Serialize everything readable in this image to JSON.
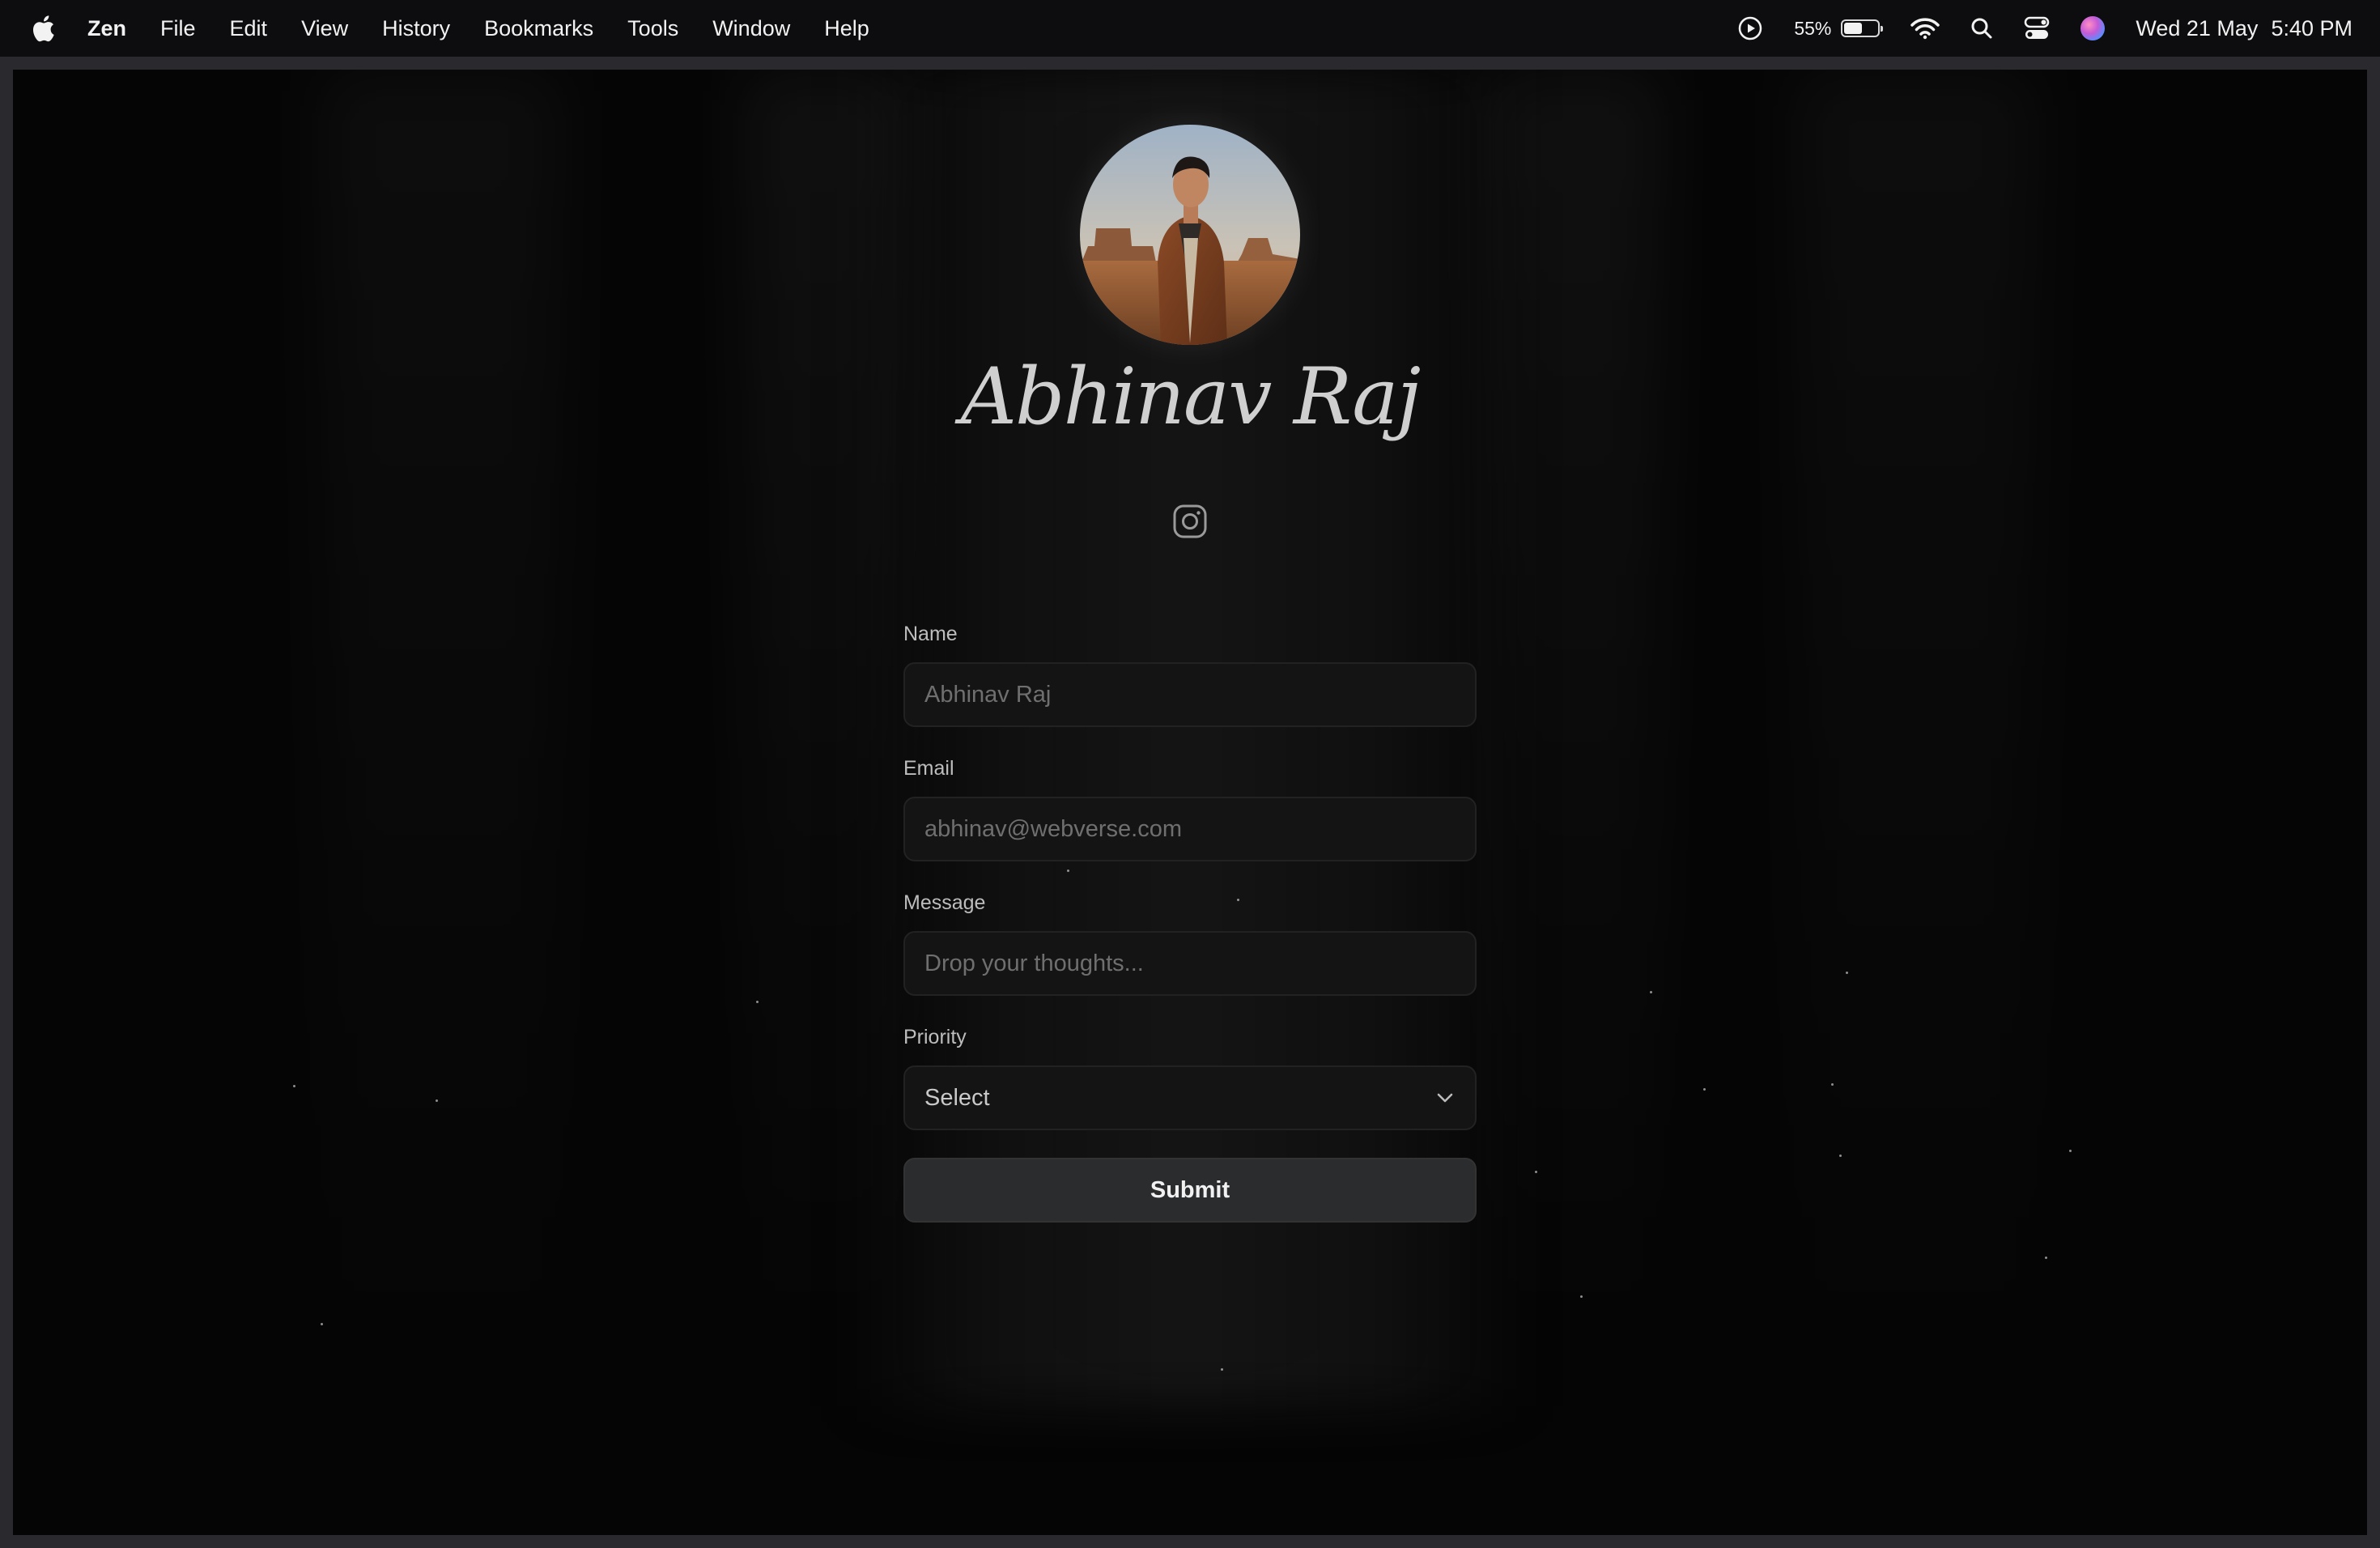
{
  "menubar": {
    "app_name": "Zen",
    "items": [
      "File",
      "Edit",
      "View",
      "History",
      "Bookmarks",
      "Tools",
      "Window",
      "Help"
    ],
    "battery_percent": "55%",
    "battery_level": 0.55,
    "date": "Wed 21 May",
    "time": "5:40 PM",
    "icons": [
      "apple-icon",
      "play-circle-icon",
      "battery-icon",
      "wifi-icon",
      "search-icon",
      "control-center-icon",
      "siri-icon"
    ]
  },
  "profile": {
    "name": "Abhinav Raj",
    "social_icon": "instagram-icon"
  },
  "form": {
    "name_label": "Name",
    "name_placeholder": "Abhinav Raj",
    "email_label": "Email",
    "email_placeholder": "abhinav@webverse.com",
    "message_label": "Message",
    "message_placeholder": "Drop your thoughts...",
    "priority_label": "Priority",
    "priority_value": "Select",
    "submit_label": "Submit"
  },
  "colors": {
    "background": "#050505",
    "field_bg": "#141414",
    "button_bg": "#2a2c2e",
    "name_color": "#cfcfcf"
  }
}
